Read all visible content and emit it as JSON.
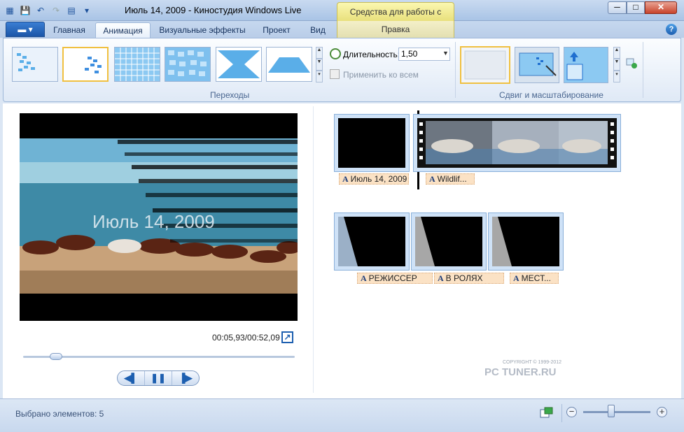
{
  "window": {
    "title": "Июль 14, 2009 - Киностудия Windows Live",
    "context_tab_header": "Средства для работы с видео",
    "minimize": "─",
    "maximize": "□",
    "close": "✕"
  },
  "ribbon_tabs": [
    {
      "label": "Главная"
    },
    {
      "label": "Анимация",
      "active": true
    },
    {
      "label": "Визуальные эффекты"
    },
    {
      "label": "Проект"
    },
    {
      "label": "Вид"
    }
  ],
  "context_tab": "Правка",
  "transitions_group": {
    "label": "Переходы",
    "duration_label": "Длительность:",
    "duration_value": "1,50",
    "apply_all": "Применить ко всем"
  },
  "pan_zoom_group": {
    "label": "Сдвиг и масштабирование"
  },
  "preview": {
    "overlay_text": "Июль 14, 2009",
    "timecode": "00:05,93/00:52,09",
    "progress": 0.12
  },
  "storyboard": {
    "row1": [
      {
        "caption": "Июль 14, 2009"
      },
      {
        "caption": "Wildlif..."
      }
    ],
    "row2": [
      {
        "caption": "РЕЖИССЕР"
      },
      {
        "caption": "В РОЛЯХ"
      },
      {
        "caption": "МЕСТ..."
      }
    ]
  },
  "watermark": {
    "main": "PC TUNER.RU",
    "copyright": "COPYRIGHT © 1999-2012"
  },
  "status": {
    "selected": "Выбрано элементов: 5",
    "zoom_level": 0.42
  },
  "colors": {
    "accent": "#1d5fb0",
    "context_tab": "#e8e07c",
    "caption_bg": "#fbe2c5"
  }
}
